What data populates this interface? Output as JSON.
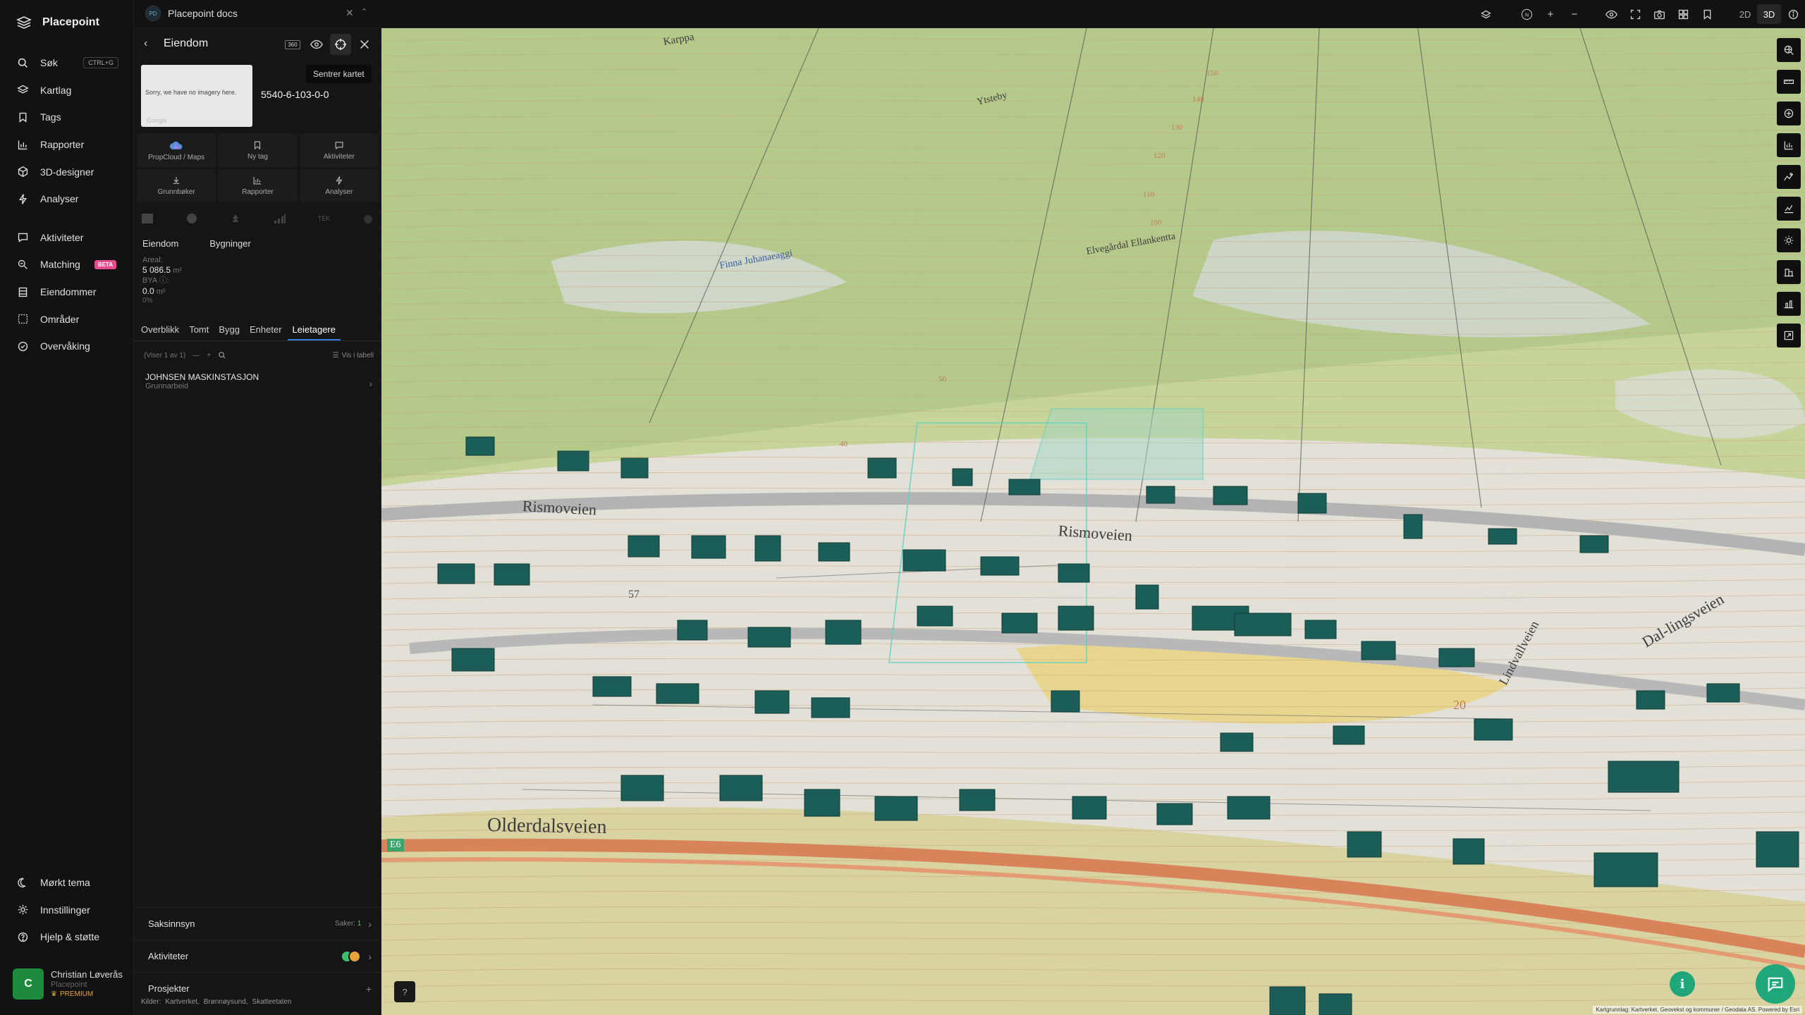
{
  "app": {
    "name": "Placepoint"
  },
  "nav": {
    "items": [
      {
        "label": "Søk",
        "shortcut": "CTRL+G",
        "icon": "search-icon"
      },
      {
        "label": "Kartlag",
        "icon": "layers-icon"
      },
      {
        "label": "Tags",
        "icon": "bookmark-icon"
      },
      {
        "label": "Rapporter",
        "icon": "chart-icon"
      },
      {
        "label": "3D-designer",
        "icon": "cube-icon"
      },
      {
        "label": "Analyser",
        "icon": "bolt-icon"
      }
    ],
    "items2": [
      {
        "label": "Aktiviteter",
        "icon": "chat-icon"
      },
      {
        "label": "Matching",
        "badge": "BETA",
        "icon": "match-icon"
      },
      {
        "label": "Eiendommer",
        "icon": "building-icon"
      },
      {
        "label": "Områder",
        "icon": "area-icon"
      },
      {
        "label": "Overvåking",
        "icon": "monitor-icon"
      }
    ],
    "bottom": [
      {
        "label": "Mørkt tema",
        "icon": "moon-icon"
      },
      {
        "label": "Innstillinger",
        "icon": "gear-icon"
      },
      {
        "label": "Hjelp & støtte",
        "icon": "help-icon"
      }
    ],
    "user": {
      "initial": "C",
      "name": "Christian Løverås",
      "org": "Placepoint",
      "plan": "PREMIUM"
    }
  },
  "topbar": {
    "doc_badge": "PD",
    "doc_title": "Placepoint docs",
    "mode_2d": "2D",
    "mode_3d": "3D",
    "compass": "N"
  },
  "panel": {
    "title": "Eiendom",
    "badge_360": "360",
    "tooltip": "Sentrer kartet",
    "thumb_msg": "Sorry, we have no imagery here.",
    "thumb_logo": "Google",
    "property_id": "5540-6-103-0-0",
    "quick": [
      {
        "label": "PropCloud / Maps",
        "icon": "cloud-icon"
      },
      {
        "label": "Ny tag",
        "icon": "bookmark-icon"
      },
      {
        "label": "Aktiviteter",
        "icon": "chat-icon"
      },
      {
        "label": "Grunnbøker",
        "icon": "download-icon"
      },
      {
        "label": "Rapporter",
        "icon": "chart-icon"
      },
      {
        "label": "Analyser",
        "icon": "bolt-icon"
      }
    ],
    "layer_tek": "TEK",
    "sub_tabs": [
      "Eiendom",
      "Bygninger"
    ],
    "stats": {
      "areal_label": "Areal:",
      "areal_value": "5 086.5",
      "areal_unit": "m²",
      "bya_label": "BYA ⓘ:",
      "bya_value": "0.0",
      "bya_unit": "m²",
      "bya_pct": "0%"
    },
    "tabs": [
      "Overblikk",
      "Tomt",
      "Bygg",
      "Enheter",
      "Leietagere"
    ],
    "active_tab": "Leietagere",
    "list_count": "(Viser 1 av 1)",
    "table_link": "Vis i tabell",
    "tenant": {
      "name": "JOHNSEN MASKINSTASJON",
      "category": "Grunnarbeid"
    },
    "accordions": {
      "saksinnsyn": "Saksinnsyn",
      "saker_label": "Saker:",
      "saker_count": "1",
      "aktiviteter": "Aktiviteter",
      "prosjekter": "Prosjekter"
    },
    "sources_label": "Kilder:",
    "sources": [
      "Kartverket,",
      "Brønnøysund,",
      "Skatteetaten"
    ]
  },
  "map": {
    "roads": [
      "Rismoveien",
      "Rismoveien",
      "Olderdalsveien",
      "Lindvallveien",
      "Dal-lingsveien",
      "Karppa",
      "Ytsteby",
      "Finna Juhanaeaggi",
      "Elvegårdal Ellankentta",
      "E6"
    ],
    "contours": [
      "150",
      "140",
      "130",
      "120",
      "110",
      "100",
      "50",
      "40",
      "57",
      "20"
    ],
    "attribution": "Kartgrunnlag: Kartverket, Geovekst og kommuner / Geodata AS. Powered by Esri"
  },
  "colors": {
    "accent": "#2f7fd8",
    "building": "#1b5e58",
    "fab": "#1fa67a",
    "beta": "#e64b8c"
  }
}
